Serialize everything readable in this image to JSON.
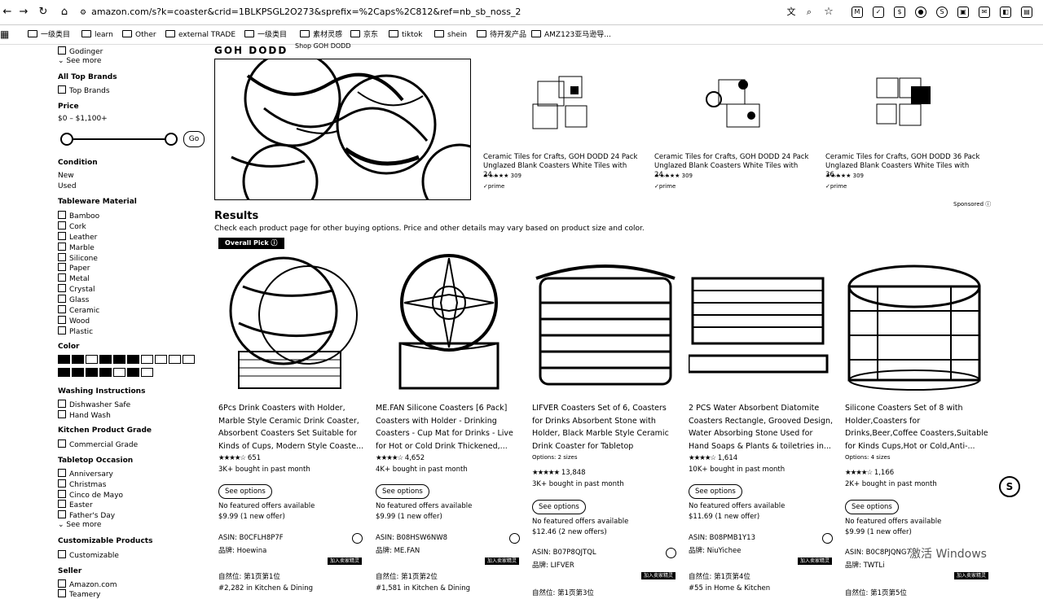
{
  "browser": {
    "url": "amazon.com/s?k=coaster&crid=1BLKPSGL2O273&sprefix=%2Caps%2C812&ref=nb_sb_noss_2",
    "bookmarks": [
      "一级类目",
      "learn",
      "Other",
      "external TRADE",
      "一级类目",
      "素材灵感",
      "京东",
      "tiktok",
      "shein",
      "待开发产品",
      "AMZ123亚马逊导..."
    ]
  },
  "sidebar": {
    "brand_item": "Godinger",
    "see_more": "See more",
    "all_top_brands": {
      "heading": "All Top Brands",
      "item": "Top Brands"
    },
    "price": {
      "heading": "Price",
      "range": "$0 – $1,100+",
      "go": "Go",
      "min_fraction": 0.0,
      "max_fraction": 1.0
    },
    "condition": {
      "heading": "Condition",
      "items": [
        "New",
        "Used"
      ]
    },
    "tableware_material": {
      "heading": "Tableware Material",
      "items": [
        "Bamboo",
        "Cork",
        "Leather",
        "Marble",
        "Silicone",
        "Paper",
        "Metal",
        "Crystal",
        "Glass",
        "Ceramic",
        "Wood",
        "Plastic"
      ]
    },
    "color": {
      "heading": "Color"
    },
    "washing": {
      "heading": "Washing Instructions",
      "items": [
        "Dishwasher Safe",
        "Hand Wash"
      ]
    },
    "kitchen_grade": {
      "heading": "Kitchen Product Grade",
      "items": [
        "Commercial Grade"
      ]
    },
    "tabletop_occasion": {
      "heading": "Tabletop Occasion",
      "items": [
        "Anniversary",
        "Christmas",
        "Cinco de Mayo",
        "Easter",
        "Father's Day"
      ],
      "see_more": "See more"
    },
    "customizable": {
      "heading": "Customizable Products",
      "items": [
        "Customizable"
      ]
    },
    "seller": {
      "heading": "Seller",
      "items": [
        "Amazon.com",
        "Teamery"
      ]
    }
  },
  "sponsored": {
    "brand_text": "GOH DODD",
    "shop_link": "Shop GOH DODD",
    "label": "Sponsored",
    "products": [
      {
        "title": "Ceramic Tiles for Crafts, GOH DODD 24 Pack Unglazed Blank Coasters White Tiles with 24...",
        "rating_count": "309",
        "prime": "✓prime"
      },
      {
        "title": "Ceramic Tiles for Crafts, GOH DODD 24 Pack Unglazed Blank Coasters White Tiles with 24...",
        "rating_count": "309",
        "prime": "✓prime"
      },
      {
        "title": "Ceramic Tiles for Crafts, GOH DODD 36 Pack Unglazed Blank Coasters White Tiles with 36...",
        "rating_count": "309",
        "prime": "✓prime"
      }
    ]
  },
  "results": {
    "heading": "Results",
    "subtext": "Check each product page for other buying options. Price and other details may vary based on product size and color.",
    "overall_pick": "Overall Pick"
  },
  "products": [
    {
      "title": "6Pcs Drink Coasters with Holder, Marble Style Ceramic Drink Coaster, Absorbent Coasters Set Suitable for Kinds of Cups, Modern Style Coaste...",
      "options": "",
      "stars": "★★★★☆",
      "reviews": "651",
      "bought": "3K+ bought in past month",
      "see_options": "See options",
      "no_offers": "No featured offers available",
      "price": "$9.99",
      "new_offers": "(1 new offer)",
      "asin": "ASIN: B0CFLH8P7F",
      "brand": "品牌: Hoewina",
      "rank1": "自然位: 第1页第1位",
      "rank2": "#2,282 in Kitchen & Dining"
    },
    {
      "title": "ME.FAN Silicone Coasters [6 Pack] Coasters with Holder - Drinking Coasters - Cup Mat for Drinks - Live for Hot or Cold Drink Thickened,...",
      "options": "",
      "stars": "★★★★☆",
      "reviews": "4,652",
      "bought": "4K+ bought in past month",
      "see_options": "See options",
      "no_offers": "No featured offers available",
      "price": "$9.99",
      "new_offers": "(1 new offer)",
      "asin": "ASIN: B08HSW6NW8",
      "brand": "品牌: ME.FAN",
      "rank1": "自然位: 第1页第2位",
      "rank2": "#1,581 in Kitchen & Dining"
    },
    {
      "title": "LIFVER Coasters Set of 6, Coasters for Drinks Absorbent Stone with Holder, Black Marble Style Ceramic Drink Coaster for Tabletop Protection,...",
      "options": "Options: 2 sizes",
      "stars": "★★★★★",
      "reviews": "13,848",
      "bought": "3K+ bought in past month",
      "see_options": "See options",
      "no_offers": "No featured offers available",
      "price": "$12.46",
      "new_offers": "(2 new offers)",
      "asin": "ASIN: B07P8QJTQL",
      "brand": "品牌: LIFVER",
      "rank1": "自然位: 第1页第3位",
      "rank2": ""
    },
    {
      "title": "2 PCS Water Absorbent Diatomite Coasters Rectangle, Grooved Design, Water Absorbing Stone Used for Hand Soaps & Plants & toiletries in...",
      "options": "",
      "stars": "★★★★☆",
      "reviews": "1,614",
      "bought": "10K+ bought in past month",
      "see_options": "See options",
      "no_offers": "No featured offers available",
      "price": "$11.69",
      "new_offers": "(1 new offer)",
      "asin": "ASIN: B08PMB1Y13",
      "brand": "品牌: NiuYichee",
      "rank1": "自然位: 第1页第4位",
      "rank2": "#55 in Home & Kitchen"
    },
    {
      "title": "Silicone Coasters Set of 8 with Holder,Coasters for Drinks,Beer,Coffee Coasters,Suitable for Kinds Cups,Hot or Cold,Anti-...",
      "options": "Options: 4 sizes",
      "stars": "★★★★☆",
      "reviews": "1,166",
      "bought": "2K+ bought in past month",
      "see_options": "See options",
      "no_offers": "No featured offers available",
      "price": "$9.99",
      "new_offers": "(1 new offer)",
      "asin": "ASIN: B0C8PJQNG7",
      "brand": "品牌: TWTLi",
      "rank1": "自然位: 第1页第5位",
      "rank2": ""
    }
  ],
  "tags": {
    "bestseller": "加入卖家精灵"
  },
  "windows_watermark": "激活 Windows"
}
